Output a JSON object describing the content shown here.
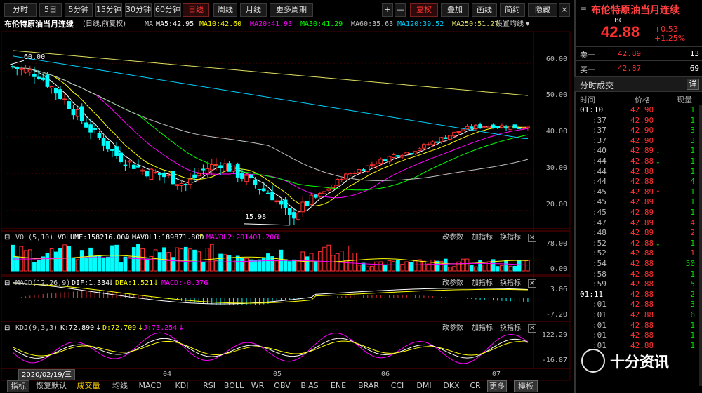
{
  "toolbar": {
    "periods": [
      "分时",
      "5日",
      "5分钟",
      "15分钟",
      "30分钟",
      "60分钟",
      "日线",
      "周线",
      "月线",
      "更多周期"
    ],
    "active": "日线",
    "right": [
      "+",
      "—",
      "复权",
      "叠加",
      "画线",
      "简约",
      "隐藏"
    ]
  },
  "chart_header": {
    "title": "布伦特原油当月连续",
    "mode": "(日线,前复权)",
    "ma_label": "MA",
    "ma": [
      {
        "name": "MA5",
        "value": "42.95",
        "color": "#ffffff"
      },
      {
        "name": "MA10",
        "value": "42.60",
        "color": "#ffff00"
      },
      {
        "name": "MA20",
        "value": "41.93",
        "color": "#ff00ff"
      },
      {
        "name": "MA30",
        "value": "41.29",
        "color": "#00ff00"
      },
      {
        "name": "MA60",
        "value": "35.63",
        "color": "#c0c0c0"
      },
      {
        "name": "MA120",
        "value": "39.52",
        "color": "#00d0ff"
      },
      {
        "name": "MA250",
        "value": "51.27",
        "color": "#e0e060"
      }
    ],
    "settings": "设置均线"
  },
  "price_axis": [
    "60.00",
    "50.00",
    "40.00",
    "30.00",
    "20.00"
  ],
  "annotations": {
    "high": "60.00",
    "low": "15.98"
  },
  "vol_header": {
    "name": "VOL(5,10)",
    "volume": "VOLUME:158216.000",
    "mavol1": "MAVOL1:189871.800",
    "mavol2": "MAVOL2:201401.200",
    "buttons": [
      "改参数",
      "加指标",
      "换指标"
    ]
  },
  "vol_axis": [
    "78.00",
    "0.00"
  ],
  "macd_header": {
    "name": "MACD(12,26,9)",
    "dif": "DIF:1.334",
    "dea": "DEA:1.521",
    "macd": "MACD:-0.376",
    "buttons": [
      "改参数",
      "加指标",
      "换指标"
    ]
  },
  "macd_axis": [
    "3.06",
    "-7.20"
  ],
  "kdj_header": {
    "name": "KDJ(9,3,3)",
    "k": "K:72.890",
    "d": "D:72.709",
    "j": "J:73.254",
    "buttons": [
      "改参数",
      "加指标",
      "换指标"
    ]
  },
  "kdj_axis": [
    "122.29",
    "-16.87"
  ],
  "time_axis": {
    "start": "2020/02/19/三",
    "labels": [
      "04",
      "05",
      "06",
      "07"
    ]
  },
  "bottom_tabs": [
    "指标",
    "恢复默认",
    "成交量",
    "均线",
    "MACD",
    "KDJ",
    "RSI",
    "BOLL",
    "WR",
    "OBV",
    "BIAS",
    "ENE",
    "BRAR",
    "CCI",
    "DMI",
    "DKX",
    "CR",
    "更多",
    "模板"
  ],
  "quote": {
    "name": "布伦特原油当月连续",
    "code": "BC",
    "price": "42.88",
    "change": "+0.53",
    "pct": "+1.25%",
    "sell_label": "卖一",
    "sell_price": "42.89",
    "sell_vol": "13",
    "buy_label": "买一",
    "buy_price": "42.87",
    "buy_vol": "69"
  },
  "trades": {
    "title": "分时成交",
    "detail_button": "详",
    "headers": [
      "时间",
      "价格",
      "现量"
    ],
    "rows": [
      [
        "01:10",
        "42.90",
        "1",
        ""
      ],
      [
        ":37",
        "42.90",
        "1",
        ""
      ],
      [
        ":37",
        "42.90",
        "3",
        ""
      ],
      [
        ":37",
        "42.90",
        "3",
        ""
      ],
      [
        ":40",
        "42.89",
        "1",
        "↓"
      ],
      [
        ":44",
        "42.88",
        "1",
        "↓"
      ],
      [
        ":44",
        "42.88",
        "1",
        ""
      ],
      [
        ":44",
        "42.88",
        "4",
        ""
      ],
      [
        ":45",
        "42.89",
        "1",
        "↑"
      ],
      [
        ":45",
        "42.89",
        "1",
        ""
      ],
      [
        ":45",
        "42.89",
        "1",
        ""
      ],
      [
        ":47",
        "42.89",
        "4",
        ""
      ],
      [
        ":48",
        "42.89",
        "2",
        ""
      ],
      [
        ":52",
        "42.88",
        "1",
        "↓"
      ],
      [
        ":52",
        "42.88",
        "1",
        ""
      ],
      [
        ":54",
        "42.88",
        "50",
        ""
      ],
      [
        ":58",
        "42.88",
        "1",
        ""
      ],
      [
        ":59",
        "42.88",
        "5",
        ""
      ],
      [
        "01:11",
        "42.88",
        "2",
        ""
      ],
      [
        ":01",
        "42.88",
        "3",
        ""
      ],
      [
        ":01",
        "42.88",
        "6",
        ""
      ],
      [
        ":01",
        "42.88",
        "1",
        ""
      ],
      [
        ":01",
        "42.88",
        "1",
        ""
      ],
      [
        ":01",
        "42.88",
        "1",
        ""
      ]
    ]
  },
  "watermark": "十分资讯",
  "chart_data": {
    "type": "candlestick",
    "ylim": [
      15,
      65
    ],
    "x_range": [
      "2020/02/19",
      "2020/07"
    ],
    "high": 60.0,
    "low": 15.98,
    "last_close": 42.88,
    "ma_latest": {
      "MA5": 42.95,
      "MA10": 42.6,
      "MA20": 41.93,
      "MA30": 41.29,
      "MA60": 35.63,
      "MA120": 39.52,
      "MA250": 51.27
    }
  }
}
